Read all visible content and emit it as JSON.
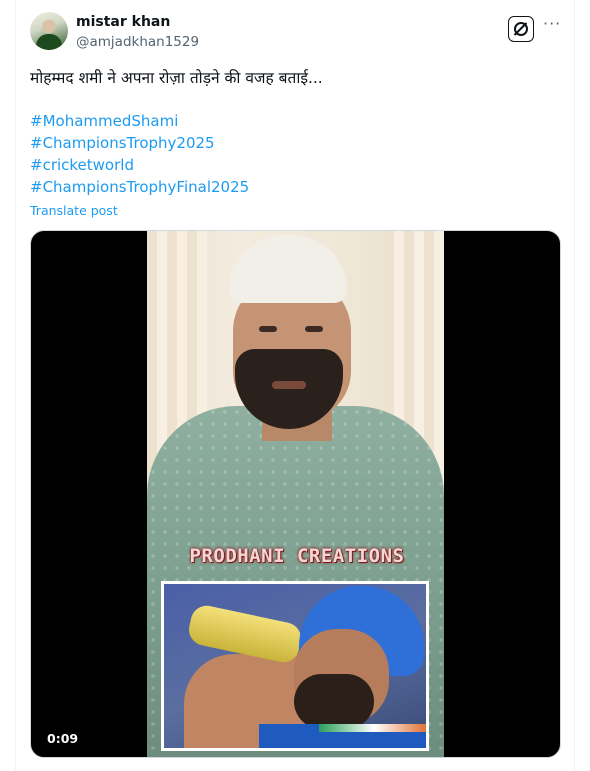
{
  "author": {
    "name": "mistar khan",
    "handle": "@amjadkhan1529"
  },
  "post": {
    "text": "मोहम्मद शमी ने अपना रोज़ा तोड़ने की वजह बताई...",
    "hashtags": [
      "#MohammedShami",
      "#ChampionsTrophy2025",
      "#cricketworld",
      "#ChampionsTrophyFinal2025"
    ],
    "translate_label": "Translate post"
  },
  "header_actions": {
    "grok_icon": "grok-icon",
    "more_label": "···"
  },
  "media": {
    "watermark": "PRODHANI CREATIONS",
    "duration": "0:09"
  },
  "colors": {
    "link": "#1d9bf0",
    "text": "#0f1419",
    "muted": "#536471"
  }
}
